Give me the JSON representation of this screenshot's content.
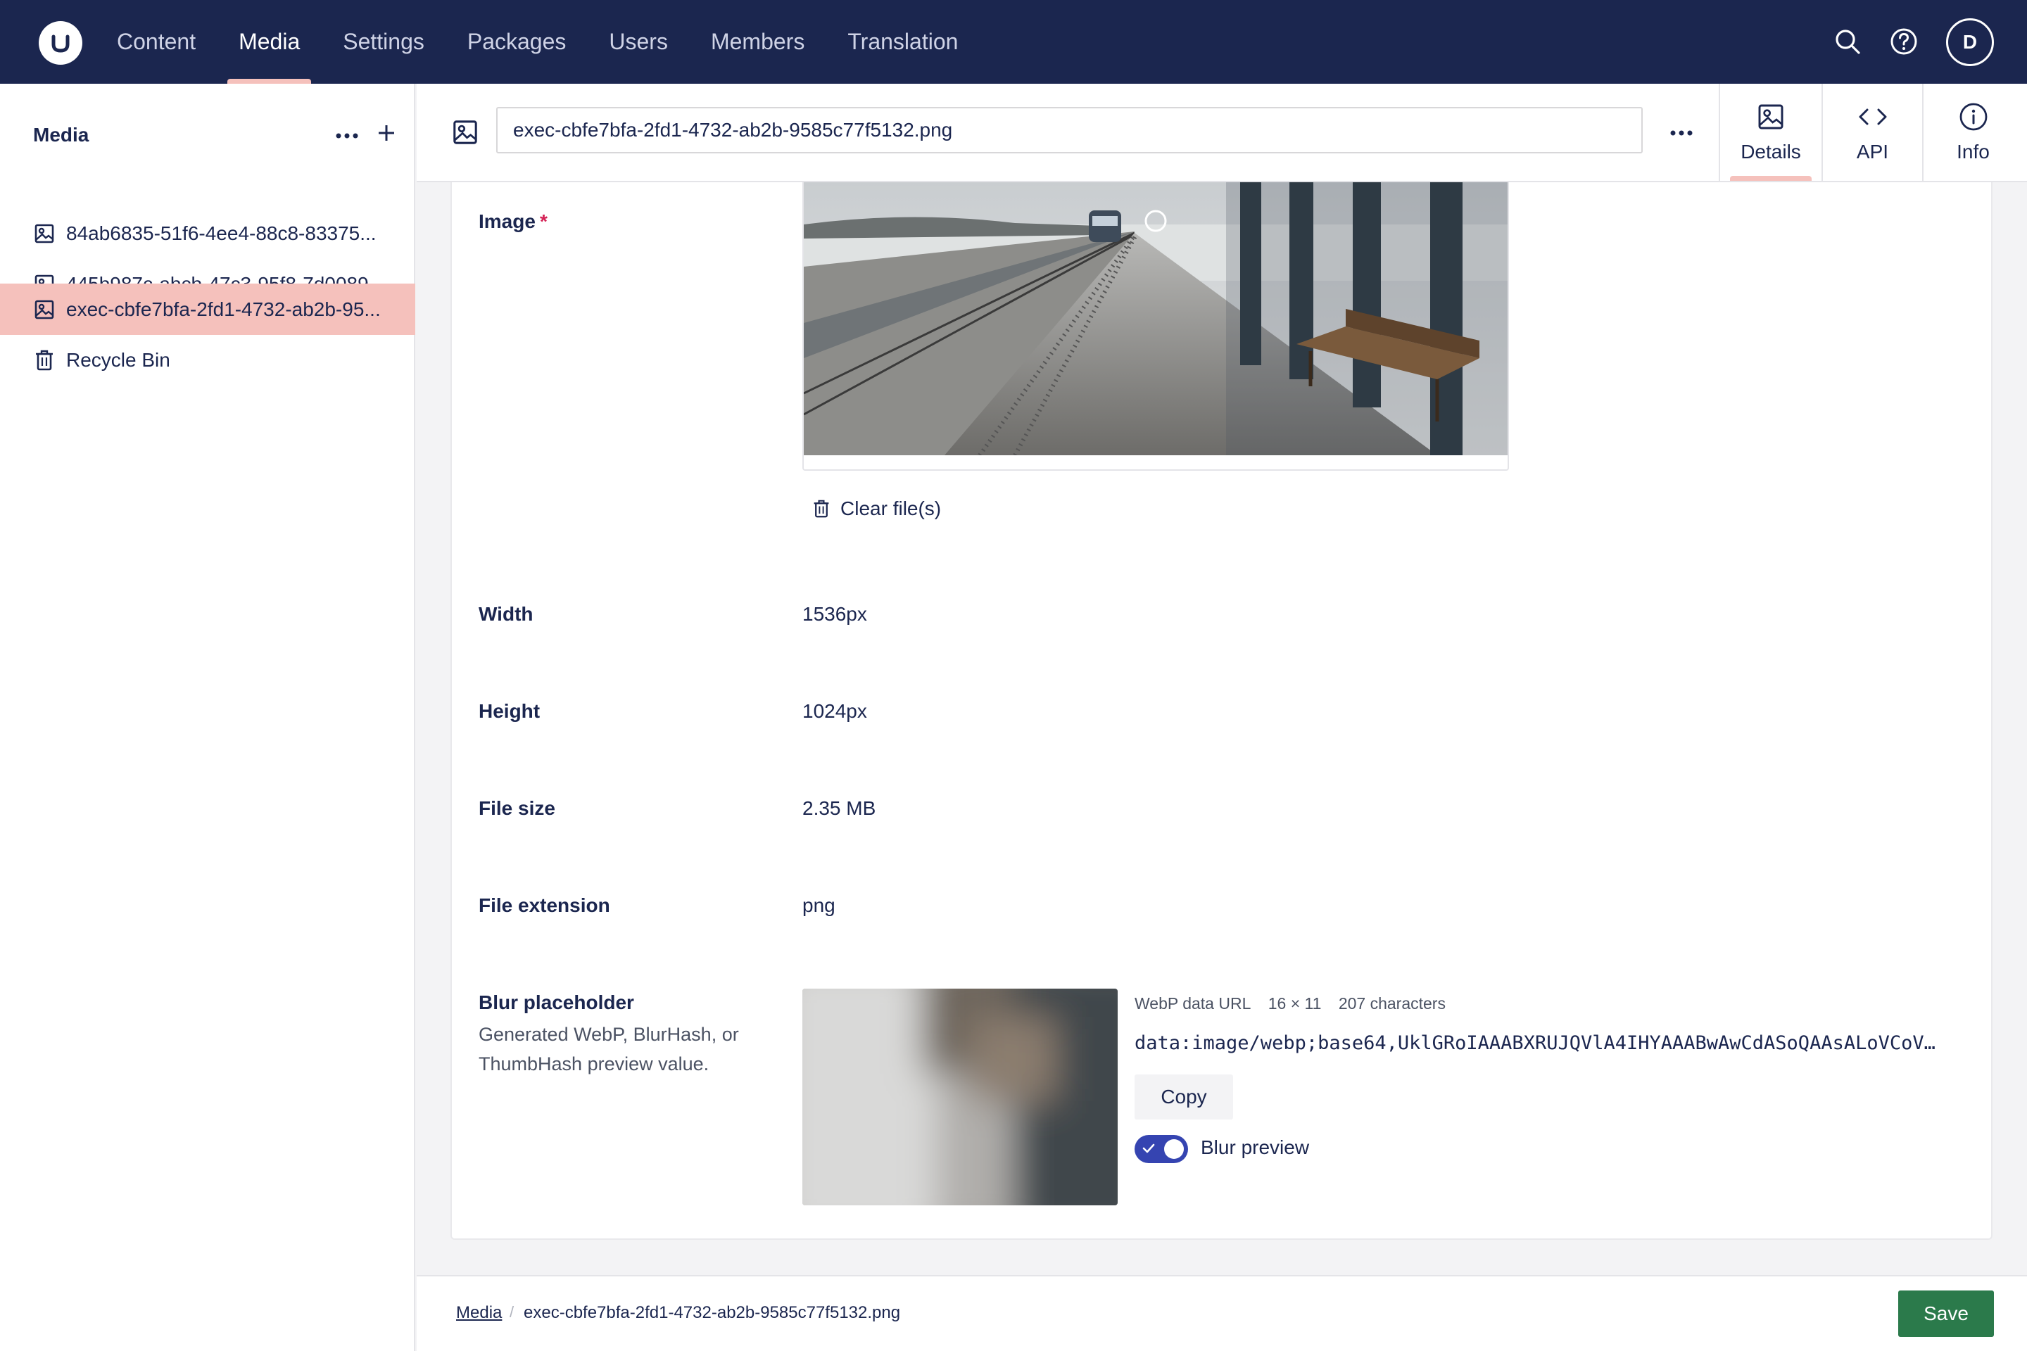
{
  "nav": {
    "items": [
      {
        "label": "Content"
      },
      {
        "label": "Media"
      },
      {
        "label": "Settings"
      },
      {
        "label": "Packages"
      },
      {
        "label": "Users"
      },
      {
        "label": "Members"
      },
      {
        "label": "Translation"
      }
    ],
    "active": "Media",
    "avatar_initial": "D",
    "icons": [
      "search-icon",
      "help-icon"
    ]
  },
  "sidebar": {
    "title": "Media",
    "items": [
      {
        "label": "84ab6835-51f6-4ee4-88c8-83375...",
        "icon": "image-icon"
      },
      {
        "label": "445b987c-abcb-47c3-95f8-7d0089...",
        "icon": "image-icon"
      },
      {
        "label": "exec-cbfe7bfa-2fd1-4732-ab2b-95...",
        "icon": "image-icon",
        "active": true
      },
      {
        "label": "Recycle Bin",
        "icon": "trash-icon"
      }
    ]
  },
  "header": {
    "name_value": "exec-cbfe7bfa-2fd1-4732-ab2b-9585c77f5132.png",
    "views": [
      {
        "label": "Details",
        "icon": "image-icon",
        "active": true
      },
      {
        "label": "API",
        "icon": "code-icon"
      },
      {
        "label": "Info",
        "icon": "info-icon"
      }
    ]
  },
  "props": {
    "image": {
      "label": "Image",
      "required": "*",
      "clear_label": "Clear file(s)"
    },
    "width": {
      "label": "Width",
      "value": "1536px"
    },
    "height": {
      "label": "Height",
      "value": "1024px"
    },
    "file_size": {
      "label": "File size",
      "value": "2.35 MB"
    },
    "file_extension": {
      "label": "File extension",
      "value": "png"
    },
    "blur": {
      "label": "Blur placeholder",
      "description": "Generated WebP, BlurHash, or ThumbHash preview value.",
      "format": "WebP data URL",
      "dims": "16 × 11",
      "chars": "207 characters",
      "data_url": "data:image/webp;base64,UklGRoIAAABXRUJQVlA4IHYAAABwAwCdASoQAAsALoVCoV…",
      "copy_label": "Copy",
      "toggle_label": "Blur preview",
      "toggle_on": true
    }
  },
  "footer": {
    "crumb_root": "Media",
    "crumb_current": "exec-cbfe7bfa-2fd1-4732-ab2b-9585c77f5132.png",
    "save_label": "Save"
  },
  "colors": {
    "topbar": "#1b264f",
    "active_accent": "#f5c1bc",
    "save": "#2b7a4b",
    "toggle": "#3544b1",
    "required": "#d42054"
  }
}
